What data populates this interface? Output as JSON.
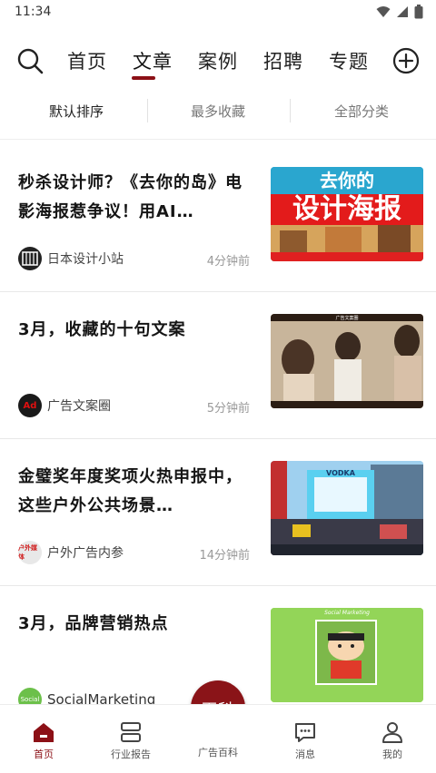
{
  "status": {
    "time": "11:34"
  },
  "nav": {
    "tabs": [
      {
        "label": "首页"
      },
      {
        "label": "文章"
      },
      {
        "label": "案例"
      },
      {
        "label": "招聘"
      },
      {
        "label": "专题"
      }
    ],
    "active_tab": "文章"
  },
  "sort": {
    "items": [
      {
        "label": "默认排序"
      },
      {
        "label": "最多收藏"
      },
      {
        "label": "全部分类"
      }
    ]
  },
  "articles": [
    {
      "title": "秒杀设计师？《去你的岛》电影海报惹争议！用AI…",
      "source": "日本设计小站",
      "time": "4分钟前"
    },
    {
      "title": "3月，收藏的十句文案",
      "source": "广告文案圈",
      "time": "5分钟前"
    },
    {
      "title": "金璧奖年度奖项火热申报中，这些户外公共场景…",
      "source": "户外广告内参",
      "time": "14分钟前"
    },
    {
      "title": "3月，品牌营销热点",
      "source": "SocialMarketing",
      "time": ""
    }
  ],
  "thumb_texts": {
    "a1": "设计海报",
    "a1_top": "去你的",
    "a2": "广告文案圈",
    "a3_sign": "VODKA",
    "a4_banner": "Social Marketing"
  },
  "avatars": {
    "a2": "Ad",
    "a3": "户外媒体",
    "a4": "Social"
  },
  "fab": {
    "label": "百科"
  },
  "bottom_nav": {
    "items": [
      {
        "label": "首页"
      },
      {
        "label": "行业报告"
      },
      {
        "label": "广告百科"
      },
      {
        "label": "消息"
      },
      {
        "label": "我的"
      }
    ]
  },
  "colors": {
    "accent": "#8c1016",
    "fab": "#8a1418"
  }
}
